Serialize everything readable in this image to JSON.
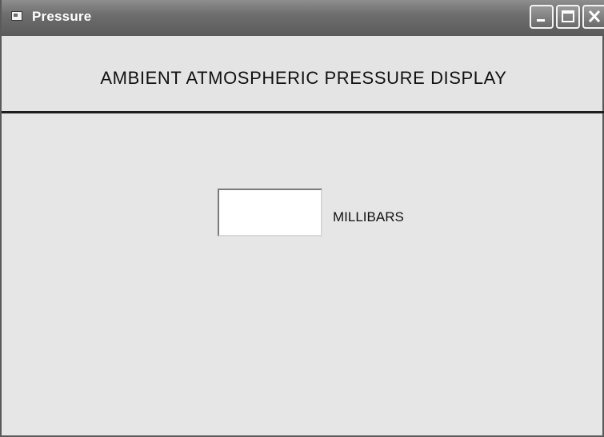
{
  "window": {
    "title": "Pressure",
    "icons": {
      "app": "window-icon",
      "minimize": "minimize-icon",
      "maximize": "maximize-icon",
      "close": "close-icon"
    }
  },
  "header": {
    "heading": "AMBIENT ATMOSPHERIC PRESSURE DISPLAY"
  },
  "reading": {
    "value": "",
    "unit": "MILLIBARS"
  }
}
